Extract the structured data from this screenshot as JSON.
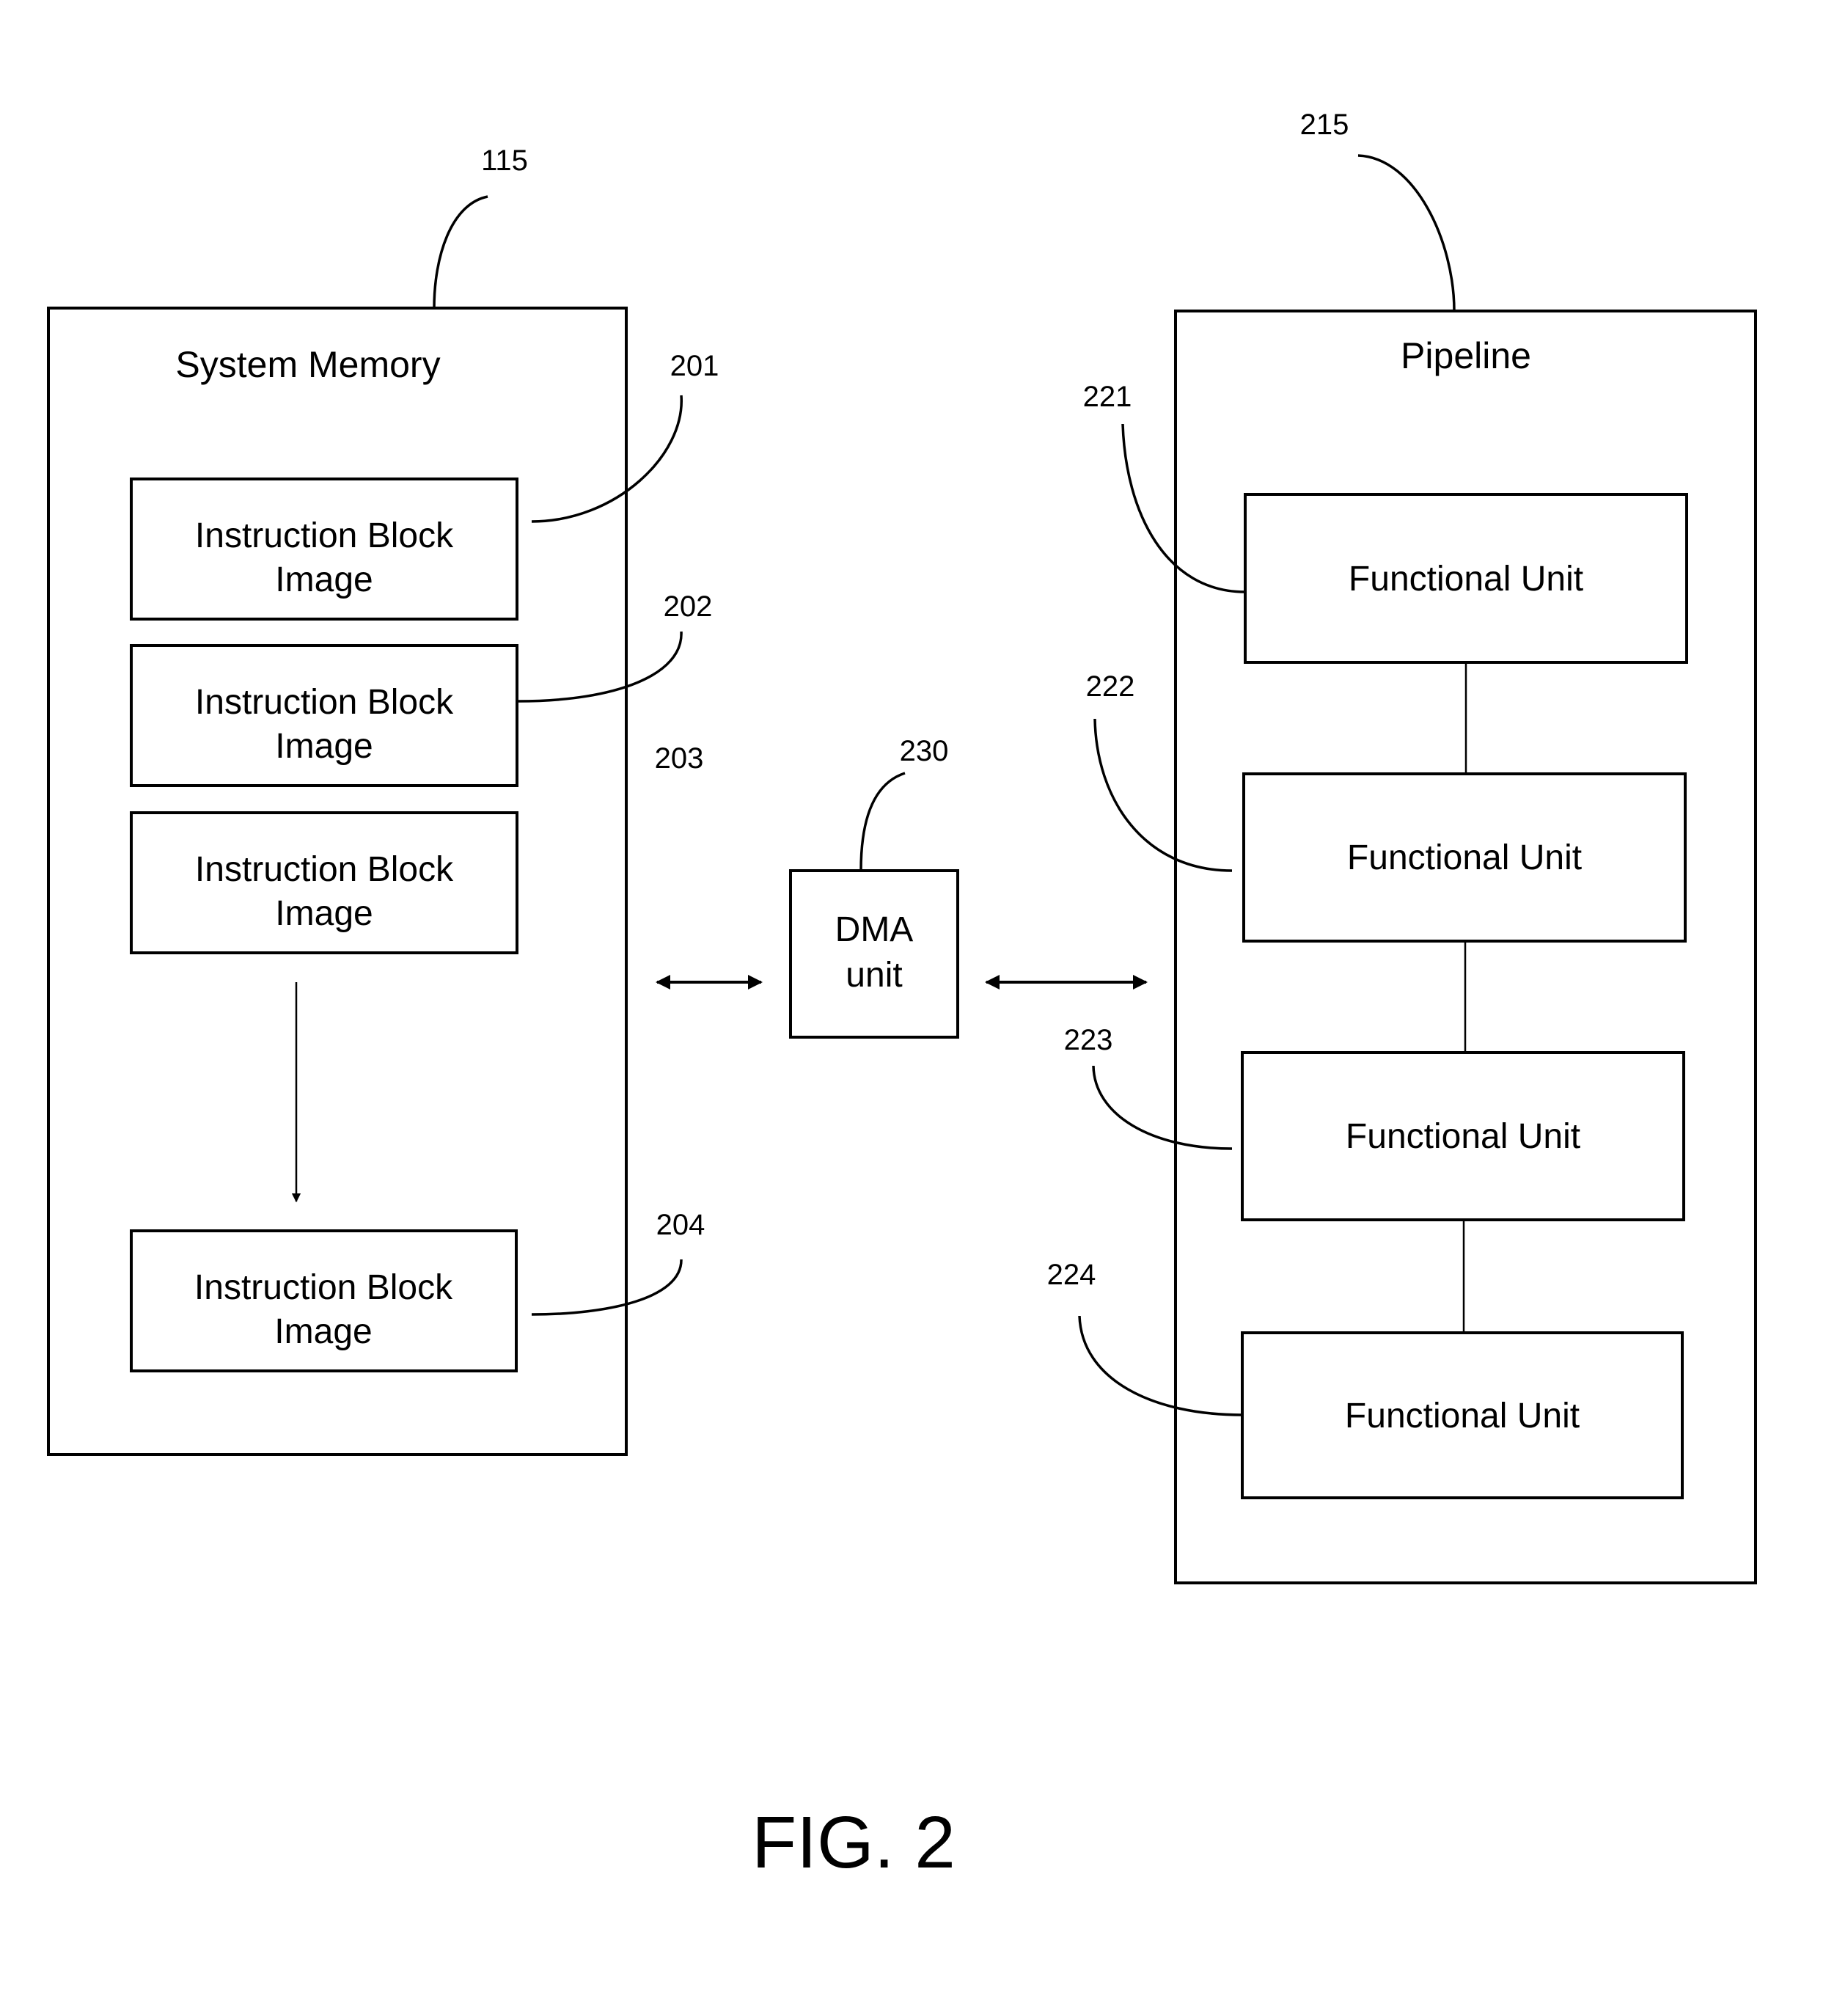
{
  "figure": {
    "caption": "FIG. 2"
  },
  "system_memory": {
    "ref": "115",
    "title": "System Memory",
    "blocks": [
      {
        "ref": "201",
        "line1": "Instruction Block",
        "line2": "Image"
      },
      {
        "ref": "202",
        "line1": "Instruction Block",
        "line2": "Image"
      },
      {
        "ref": "203",
        "line1": "Instruction Block",
        "line2": "Image"
      },
      {
        "ref": "204",
        "line1": "Instruction Block",
        "line2": "Image"
      }
    ]
  },
  "dma": {
    "ref": "230",
    "line1": "DMA",
    "line2": "unit"
  },
  "pipeline": {
    "ref": "215",
    "title": "Pipeline",
    "units": [
      {
        "ref": "221",
        "label": "Functional Unit"
      },
      {
        "ref": "222",
        "label": "Functional Unit"
      },
      {
        "ref": "223",
        "label": "Functional Unit"
      },
      {
        "ref": "224",
        "label": "Functional Unit"
      }
    ]
  },
  "colors": {
    "stroke": "#000000",
    "background": "#ffffff"
  }
}
